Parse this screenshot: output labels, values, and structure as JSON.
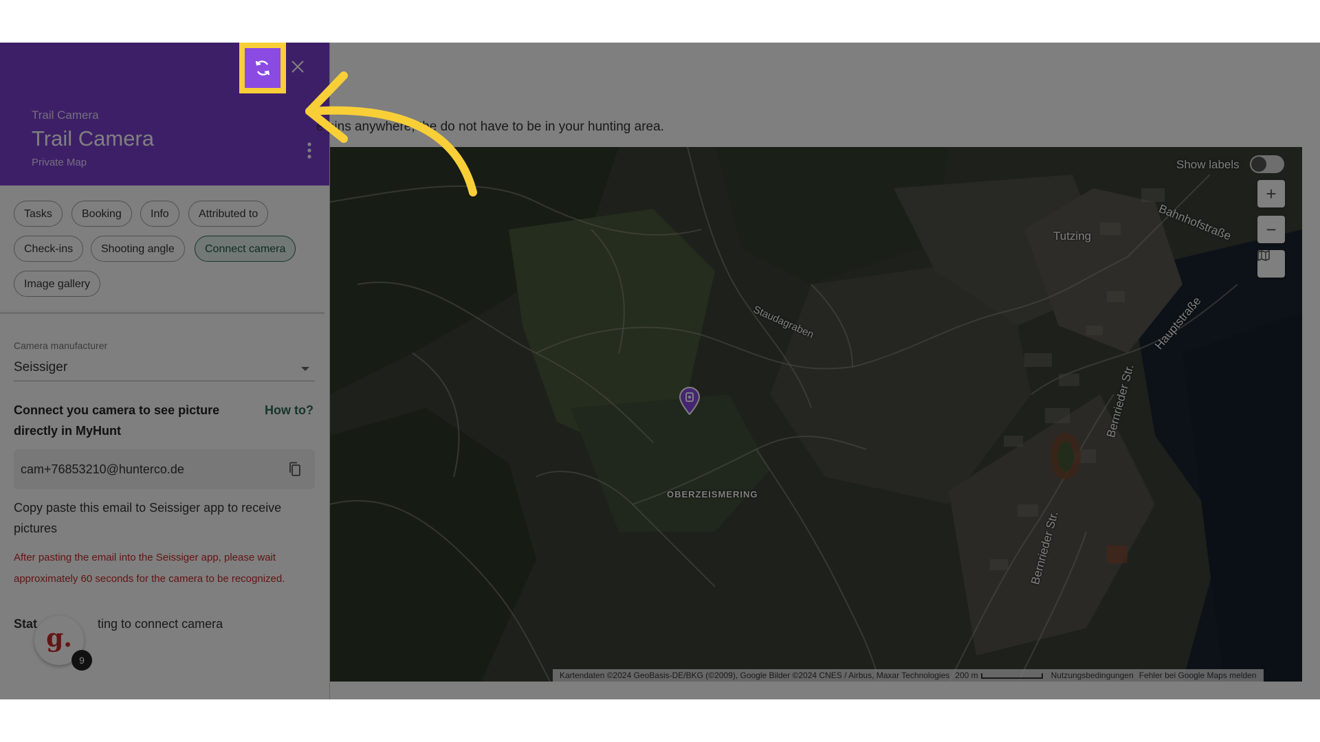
{
  "header": {
    "subtitle": "Trail Camera",
    "title": "Trail Camera",
    "map_type": "Private Map"
  },
  "tabs": [
    "Tasks",
    "Booking",
    "Info",
    "Attributed to",
    "Check-ins",
    "Shooting angle",
    "Connect camera",
    "Image gallery"
  ],
  "active_tab": "Connect camera",
  "camera": {
    "manufacturer_label": "Camera manufacturer",
    "manufacturer_value": "Seissiger",
    "connect_title": "Connect you camera to see picture directly in MyHunt",
    "how_to_label": "How to?",
    "email": "cam+76853210@hunterco.de",
    "copy_hint": "Copy paste this email to Seissiger app to receive pictures",
    "warning": "After pasting the email into the Seissiger app, please wait approximately 60 seconds for the camera to be recognized.",
    "status_prefix": "Stat",
    "status_text": "ting to connect camera"
  },
  "avatar": {
    "letter": "g.",
    "badge": "9"
  },
  "intro_text": "e pins anywhere, the   do not have to be in your hunting area.",
  "map": {
    "show_labels": "Show labels",
    "labels": {
      "bahnhof": "Bahnhofstraße",
      "tutzing": "Tutzing",
      "staudagraben": "Staudagraben",
      "hauptstrasse": "Hauptstraße",
      "bernrieder1": "Bernrieder Str.",
      "bernrieder2": "Bernrieder Str.",
      "oberzeismering": "OBERZEISMERING"
    },
    "zoom_in": "+",
    "zoom_out": "−",
    "attribution": "Kartendaten ©2024 GeoBasis-DE/BKG (©2009), Google Bilder ©2024 CNES / Airbus, Maxar Technologies",
    "scale": "200 m",
    "terms": "Nutzungsbedingungen",
    "report": "Fehler bei Google Maps melden"
  },
  "colors": {
    "header_purple": "#7b3fd0",
    "highlight_yellow": "#f9cf37",
    "accent_green": "#2c6b58",
    "warning_red": "#c62828"
  },
  "icons": {
    "refresh": "refresh-icon",
    "close": "close-icon",
    "kebab": "more-vert-icon",
    "copy": "copy-icon",
    "map_type": "map-layers-icon",
    "pin": "trail-camera-pin-icon",
    "arrow": "tutorial-arrow"
  }
}
